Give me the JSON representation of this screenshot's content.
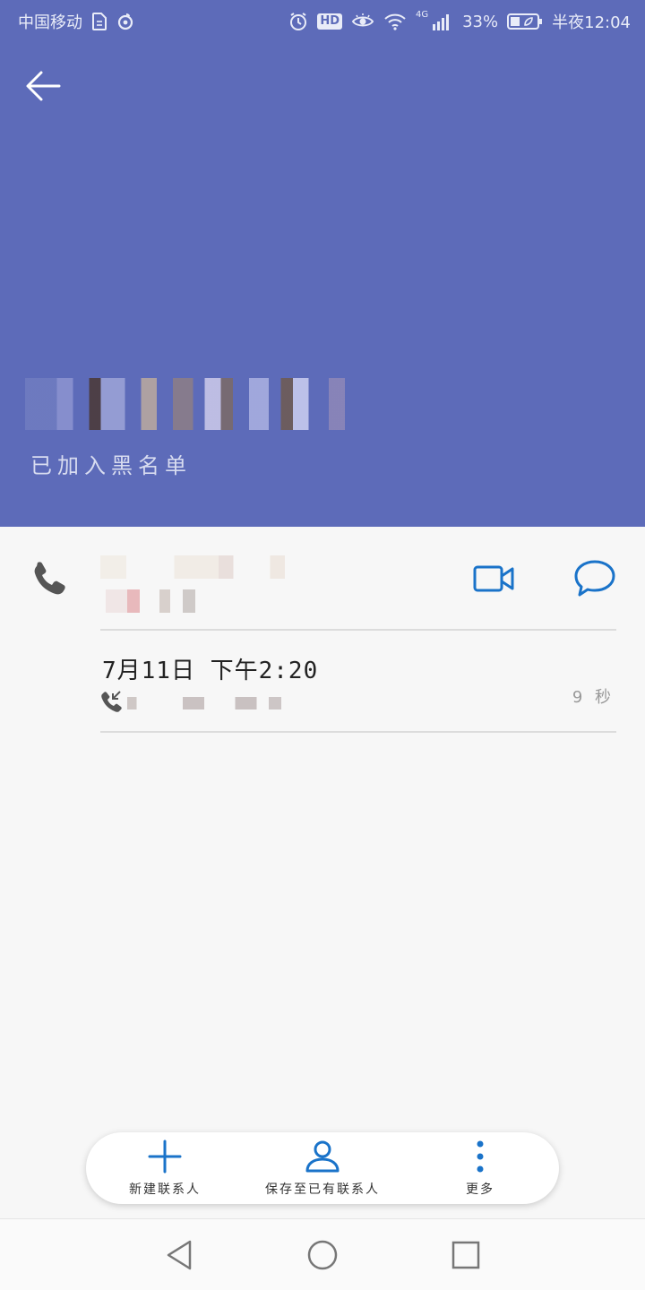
{
  "status_bar": {
    "carrier": "中国移动",
    "battery_percent": "33%",
    "time": "半夜12:04",
    "network": "4G",
    "hd_label": "HD"
  },
  "header": {
    "blocklist_status": "已加入黑名单"
  },
  "number_row": {
    "icons": [
      "phone-icon",
      "video-call-icon",
      "message-icon"
    ]
  },
  "call_log": {
    "entries": [
      {
        "datetime": "7月11日 下午2:20",
        "duration": "9 秒",
        "direction": "incoming-call-icon"
      }
    ]
  },
  "actions": {
    "new_contact": "新建联系人",
    "save_to_existing": "保存至已有联系人",
    "more": "更多"
  },
  "colors": {
    "header_bg": "#5d6bb9",
    "accent_blue": "#1a73c9",
    "background": "#f7f7f7"
  }
}
